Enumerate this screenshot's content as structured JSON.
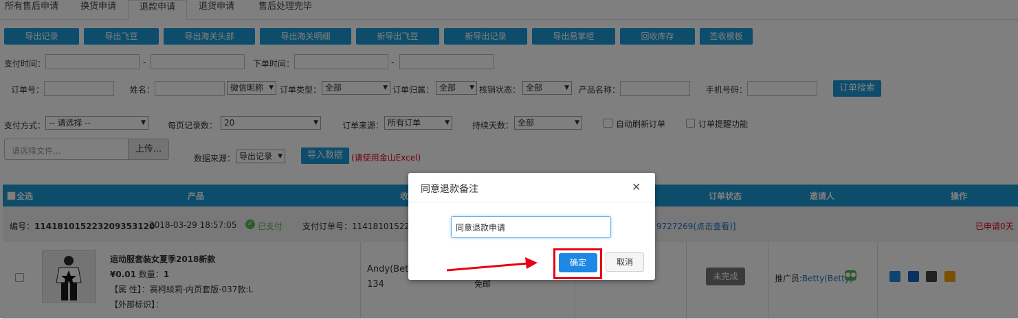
{
  "tabs": [
    {
      "label": "所有售后申请"
    },
    {
      "label": "换货申请"
    },
    {
      "label": "退款申请"
    },
    {
      "label": "退货申请"
    },
    {
      "label": "售后处理完毕"
    }
  ],
  "toolbar": {
    "buttons": [
      "导出记录",
      "导出飞豆",
      "导出海关头部",
      "导出海关明细",
      "新导出飞豆",
      "新导出记录",
      "导出易掌柜",
      "回收库存",
      "签收模板"
    ]
  },
  "filters": {
    "pay_time_label": "支付时间：",
    "order_time_label": "下单时间：",
    "dash": "-",
    "order_no_label": "订单号：",
    "name_label": "姓名：",
    "nickname_select": "微信昵称",
    "order_type_label": "订单类型：",
    "order_type_value": "全部",
    "order_owner_label": "订单归属：",
    "order_owner_value": "全部",
    "verify_status_label": "核销状态：",
    "verify_status_value": "全部",
    "product_name_label": "产品名称：",
    "phone_label": "手机号码：",
    "search_button": "订单搜索",
    "pay_method_label": "支付方式：",
    "pay_method_value": "-- 请选择 --",
    "page_size_label": "每页记录数：",
    "page_size_value": "20",
    "order_source_label": "订单来源：",
    "order_source_value": "所有订单",
    "duration_label": "持续天数：",
    "duration_value": "全部",
    "auto_refresh_label": "自动刷新订单",
    "order_remind_label": "订单提醒功能",
    "file_placeholder": "请选择文件...",
    "upload_button": "上传...",
    "data_source_label": "数据来源：",
    "data_source_value": "导出记录",
    "import_button": "导入数据",
    "import_hint": "(请使用金山Excel)"
  },
  "table": {
    "headers": {
      "select_all": "全选",
      "product": "产品",
      "receiver": "收",
      "order_status": "订单状态",
      "inviter": "邀请人",
      "actions": "操作"
    },
    "order": {
      "number_label": "编号：",
      "number": "114181015223209353120",
      "datetime": "2018-03-29 18:57:05",
      "paid_status": "已支付",
      "pay_order_label": "支付订单号：",
      "pay_order_no": "1141810152236",
      "link_tail": "9727269(点击查看)]",
      "applied_days": "已申请0天"
    },
    "item": {
      "title": "运动服套装女夏季2018新款",
      "price": "¥0.01",
      "qty_label": "数量：",
      "qty": "1",
      "attr_label": "【属 性】：",
      "attr": "赛柯緂莉-内页套版-037款:L",
      "external_label": "【外部标识】：",
      "buyer_name": "Andy(Betty",
      "buyer_phone": "134",
      "shipping": "免邮",
      "status_badge": "未完成",
      "promoter_label": "推广员:",
      "promoter": "Betty(Betty)"
    }
  },
  "modal": {
    "title": "同意退款备注",
    "close_glyph": "✕",
    "input_value": "同意退款申请",
    "confirm": "确定",
    "cancel": "取消"
  },
  "colors": {
    "accent": "#1a9bd6",
    "highlight": "#e60012",
    "confirm": "#1e88e5"
  }
}
